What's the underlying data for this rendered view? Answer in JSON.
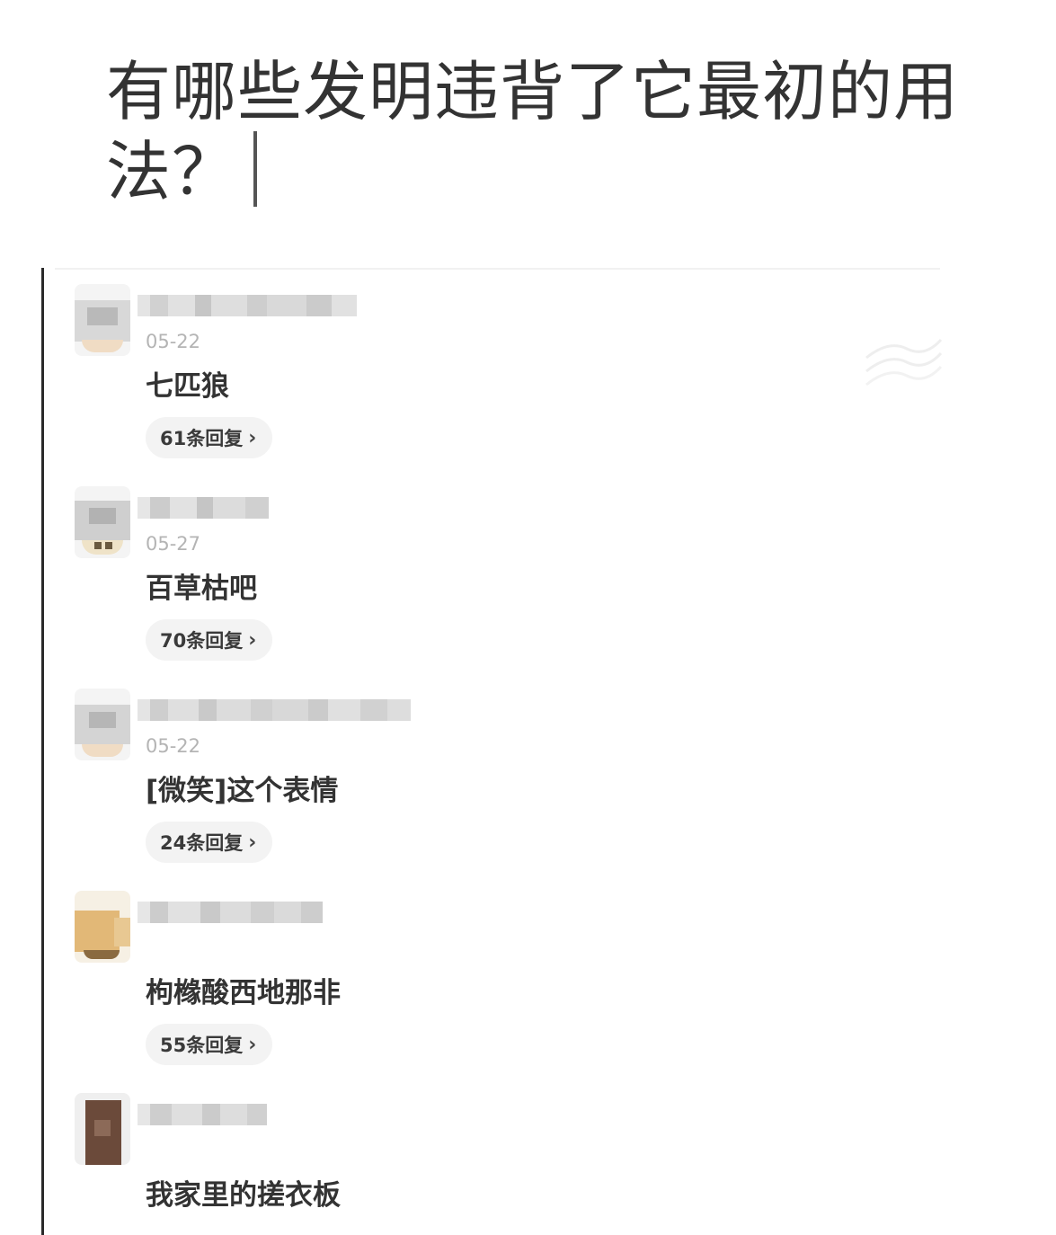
{
  "question": {
    "title": "有哪些发明违背了它最初的用法？"
  },
  "comments": [
    {
      "date": "05-22",
      "text": "七匹狼",
      "replies": "61条回复"
    },
    {
      "date": "05-27",
      "text": "百草枯吧",
      "replies": "70条回复"
    },
    {
      "date": "05-22",
      "text": "[微笑]这个表情",
      "replies": "24条回复"
    },
    {
      "date": "",
      "text": "枸橼酸西地那非",
      "replies": "55条回复"
    },
    {
      "date": "",
      "text": "我家里的搓衣板",
      "replies": ""
    }
  ],
  "icons": {
    "reply_chevron": "chevron-right-icon"
  },
  "colors": {
    "text": "#333333",
    "date": "#b4b4b4",
    "pill_bg": "#f3f3f3"
  }
}
